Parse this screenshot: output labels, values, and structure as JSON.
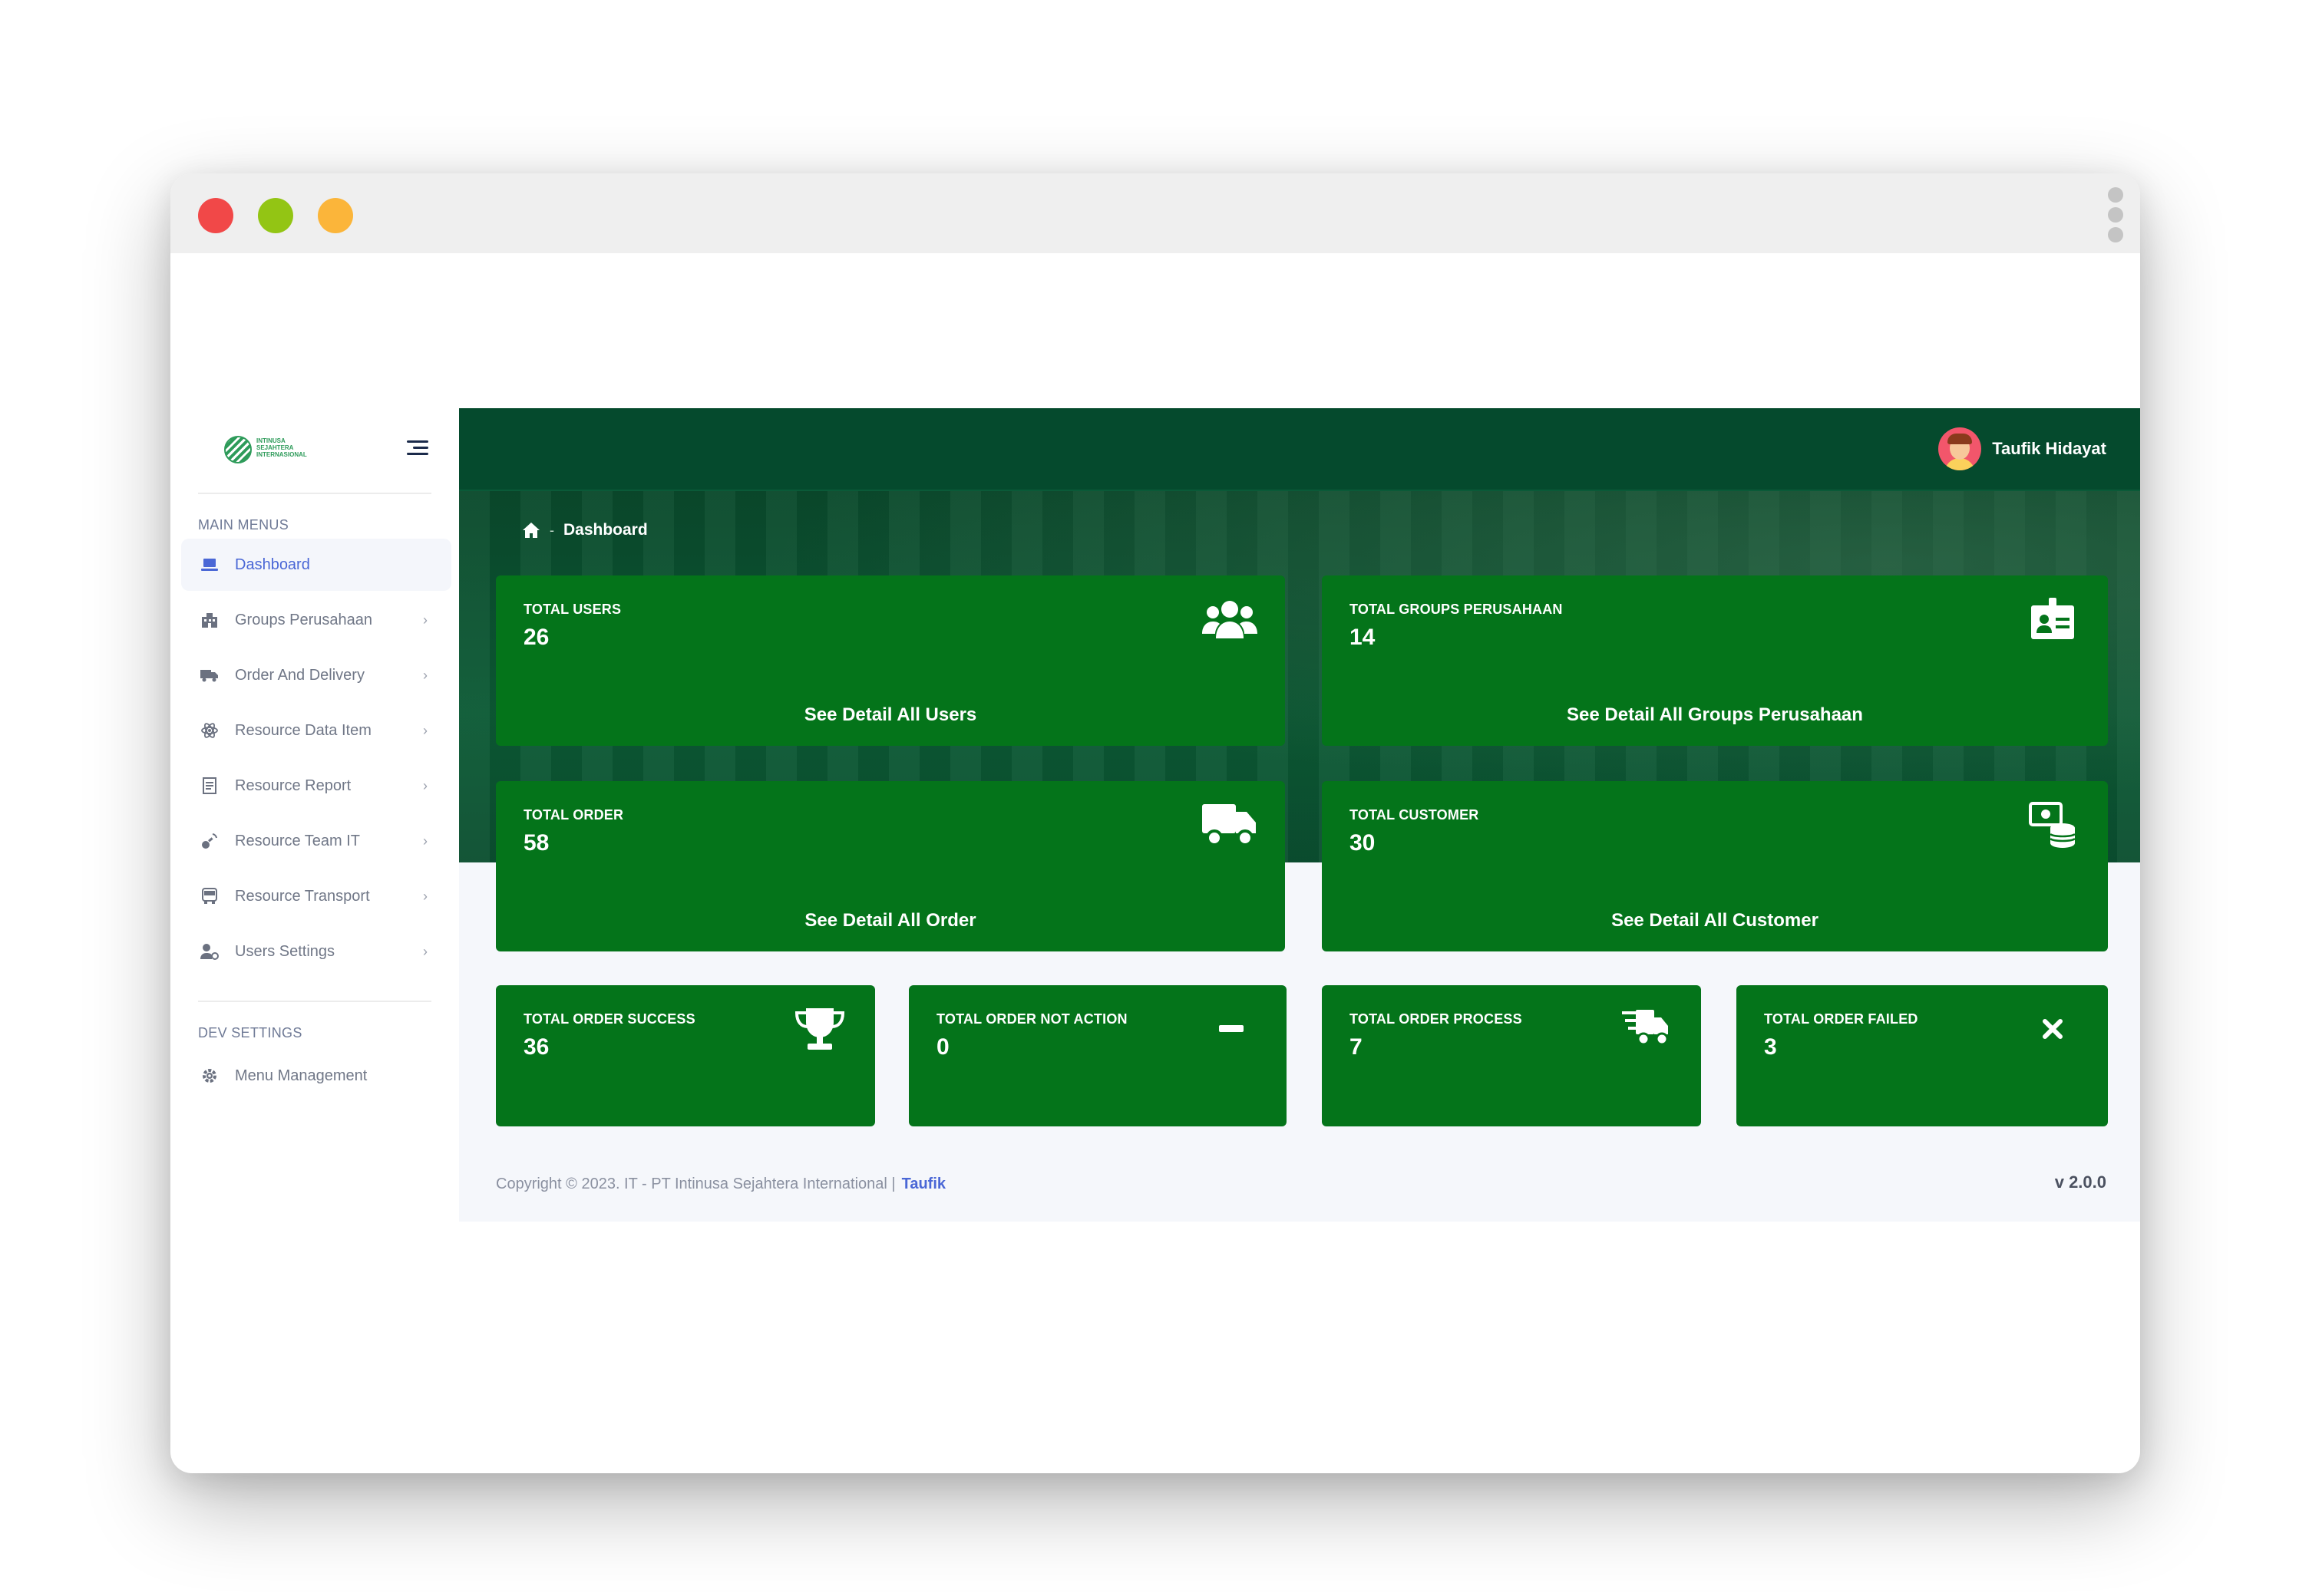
{
  "window": {
    "controls": [
      "close",
      "minimize",
      "maximize"
    ]
  },
  "sidebar": {
    "logo_text": "INTINUSA SEJAHTERA INTERNASIONAL",
    "sections": [
      {
        "label": "MAIN MENUS"
      },
      {
        "label": "DEV SETTINGS"
      }
    ],
    "items": [
      {
        "label": "Dashboard",
        "icon": "laptop-icon",
        "active": true
      },
      {
        "label": "Groups Perusahaan",
        "icon": "building-icon"
      },
      {
        "label": "Order And Delivery",
        "icon": "truck-icon"
      },
      {
        "label": "Resource Data Item",
        "icon": "atom-icon"
      },
      {
        "label": "Resource Report",
        "icon": "report-icon"
      },
      {
        "label": "Resource Team IT",
        "icon": "satellite-icon"
      },
      {
        "label": "Resource Transport",
        "icon": "bus-icon"
      },
      {
        "label": "Users Settings",
        "icon": "user-cog-icon"
      }
    ],
    "dev_items": [
      {
        "label": "Menu Management",
        "icon": "gear-icon"
      }
    ]
  },
  "header": {
    "user_name": "Taufik Hidayat"
  },
  "breadcrumb": {
    "current": "Dashboard"
  },
  "cards": {
    "users": {
      "label": "TOTAL USERS",
      "value": "26",
      "link": "See Detail All Users",
      "icon": "users-icon"
    },
    "groups": {
      "label": "TOTAL GROUPS PERUSAHAAN",
      "value": "14",
      "link": "See Detail All Groups Perusahaan",
      "icon": "id-card-icon"
    },
    "order": {
      "label": "TOTAL ORDER",
      "value": "58",
      "link": "See Detail All Order",
      "icon": "truck-icon"
    },
    "customer": {
      "label": "TOTAL CUSTOMER",
      "value": "30",
      "link": "See Detail All Customer",
      "icon": "money-stack-icon"
    },
    "success": {
      "label": "TOTAL ORDER SUCCESS",
      "value": "36",
      "icon": "trophy-icon"
    },
    "not_action": {
      "label": "TOTAL ORDER NOT ACTION",
      "value": "0",
      "icon": "minus-icon"
    },
    "process": {
      "label": "TOTAL ORDER PROCESS",
      "value": "7",
      "icon": "fast-truck-icon"
    },
    "failed": {
      "label": "TOTAL ORDER FAILED",
      "value": "3",
      "icon": "close-icon"
    }
  },
  "footer": {
    "copyright": "Copyright © 2023. IT - PT Intinusa Sejahtera International |",
    "author": "Taufik",
    "version": "v 2.0.0"
  },
  "colors": {
    "card": "#04741a",
    "topbar": "#054a2d",
    "accent": "#4a67d6"
  }
}
